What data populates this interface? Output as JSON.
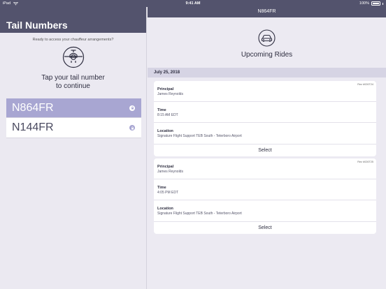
{
  "status_bar": {
    "device": "iPad",
    "time": "9:41 AM",
    "battery": "100%"
  },
  "left_pane": {
    "title": "Tail Numbers",
    "subtitle": "Ready to access your chauffeur arrangements?",
    "prompt_line1": "Tap your tail number",
    "prompt_line2": "to continue",
    "tail_numbers": [
      {
        "label": "N864FR",
        "selected": true
      },
      {
        "label": "N144FR",
        "selected": false
      }
    ]
  },
  "right_pane": {
    "header_title": "N864FR",
    "section_title": "Upcoming Rides",
    "date": "July 25, 2018",
    "rides": [
      {
        "ride_number": "Rez #026T24",
        "principal_label": "Principal",
        "principal": "James Reynolds",
        "time_label": "Time",
        "time": "8:15 AM EDT",
        "location_label": "Location",
        "location": "Signature Flight Support TEB South - Teterboro Airport",
        "select_label": "Select"
      },
      {
        "ride_number": "Rez #026T25",
        "principal_label": "Principal",
        "principal": "James Reynolds",
        "time_label": "Time",
        "time": "4:05 PM EDT",
        "location_label": "Location",
        "location": "Signature Flight Support TEB South - Teterboro Airport",
        "select_label": "Select"
      }
    ]
  },
  "colors": {
    "header": "#53536d",
    "accent": "#a8a6d2",
    "background": "#eceaf2"
  }
}
